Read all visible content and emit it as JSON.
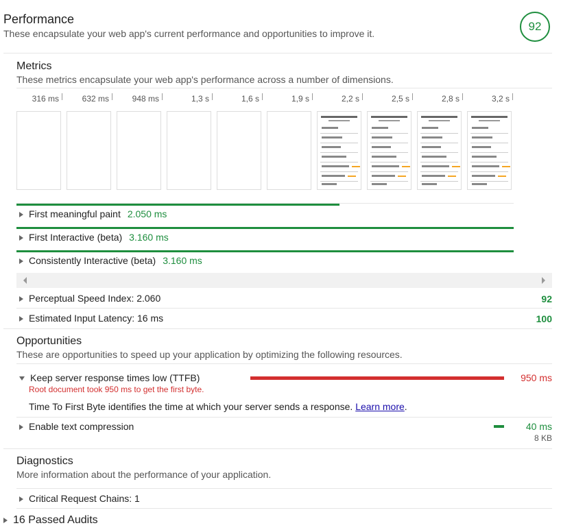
{
  "category": {
    "title": "Performance",
    "description": "These encapsulate your web app's current performance and opportunities to improve it.",
    "score": "92",
    "score_color": "#1e8e3e"
  },
  "metrics": {
    "title": "Metrics",
    "description": "These metrics encapsulate your web app's performance across a number of dimensions.",
    "timeline_ticks": [
      "316 ms",
      "632 ms",
      "948 ms",
      "1,3 s",
      "1,6 s",
      "1,9 s",
      "2,2 s",
      "2,5 s",
      "2,8 s",
      "3,2 s"
    ],
    "thumbnail_count": 10,
    "thumbnails_with_content": 4,
    "bars": [
      {
        "label": "First meaningful paint",
        "value": "2.050 ms",
        "bar_fraction": 0.65
      },
      {
        "label": "First Interactive (beta)",
        "value": "3.160 ms",
        "bar_fraction": 1.0
      },
      {
        "label": "Consistently Interactive (beta)",
        "value": "3.160 ms",
        "bar_fraction": 1.0
      }
    ],
    "scored": [
      {
        "label": "Perceptual Speed Index: 2.060",
        "score": "92"
      },
      {
        "label": "Estimated Input Latency: 16 ms",
        "score": "100"
      }
    ]
  },
  "opportunities": {
    "title": "Opportunities",
    "description": "These are opportunities to speed up your application by optimizing the following resources.",
    "items": [
      {
        "label": "Keep server response times low (TTFB)",
        "value": "950 ms",
        "warning": "Root document took 950 ms to get the first byte.",
        "help_text": "Time To First Byte identifies the time at which your server sends a response.",
        "link_text": "Learn more",
        "bar_color": "#d32f2f",
        "bar_fraction": 1.0
      },
      {
        "label": "Enable text compression",
        "value": "40 ms",
        "sub_value": "8 KB",
        "bar_color": "#1e8e3e",
        "bar_fraction": 0.04
      }
    ]
  },
  "diagnostics": {
    "title": "Diagnostics",
    "description": "More information about the performance of your application.",
    "items": [
      {
        "label": "Critical Request Chains: 1"
      }
    ]
  },
  "passed": {
    "label": "16 Passed Audits"
  }
}
